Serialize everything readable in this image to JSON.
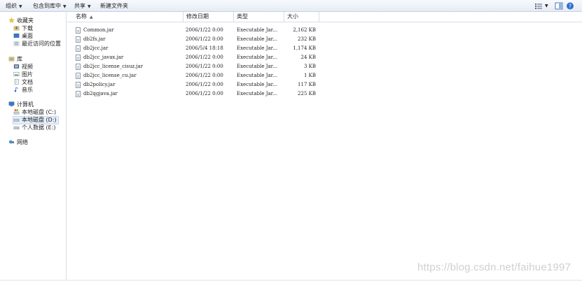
{
  "toolbar": {
    "organize": "组织",
    "include_in_library": "包含到库中",
    "share": "共享",
    "new_folder": "新建文件夹"
  },
  "sidebar": {
    "favorites": {
      "label": "收藏夹",
      "items": [
        "下载",
        "桌面",
        "最近访问的位置"
      ]
    },
    "libraries": {
      "label": "库",
      "items": [
        "视频",
        "图片",
        "文档",
        "音乐"
      ]
    },
    "computer": {
      "label": "计算机",
      "items": [
        "本地磁盘 (C:)",
        "本地磁盘 (D:)",
        "个人数据 (E:)"
      ]
    },
    "network": {
      "label": "网络"
    }
  },
  "columns": {
    "name": "名称",
    "modified": "修改日期",
    "type": "类型",
    "size": "大小"
  },
  "files": [
    {
      "name": "Common.jar",
      "modified": "2006/1/22 0:00",
      "type": "Executable Jar...",
      "size": "2,162 KB"
    },
    {
      "name": "db2fs.jar",
      "modified": "2006/1/22 0:00",
      "type": "Executable Jar...",
      "size": "232 KB"
    },
    {
      "name": "db2jcc.jar",
      "modified": "2006/5/4 18:18",
      "type": "Executable Jar...",
      "size": "1,174 KB"
    },
    {
      "name": "db2jcc_javax.jar",
      "modified": "2006/1/22 0:00",
      "type": "Executable Jar...",
      "size": "24 KB"
    },
    {
      "name": "db2jcc_license_cisuz.jar",
      "modified": "2006/1/22 0:00",
      "type": "Executable Jar...",
      "size": "3 KB"
    },
    {
      "name": "db2jcc_license_cu.jar",
      "modified": "2006/1/22 0:00",
      "type": "Executable Jar...",
      "size": "1 KB"
    },
    {
      "name": "db2policy.jar",
      "modified": "2006/1/22 0:00",
      "type": "Executable Jar...",
      "size": "117 KB"
    },
    {
      "name": "db2qgjava.jar",
      "modified": "2006/1/22 0:00",
      "type": "Executable Jar...",
      "size": "225 KB"
    }
  ],
  "watermark": "https://blog.csdn.net/faihue1997",
  "colors": {
    "toolbar_bg": "#e6ecf5",
    "selected_bg": "#e5eefa",
    "border": "#d5dce6"
  }
}
